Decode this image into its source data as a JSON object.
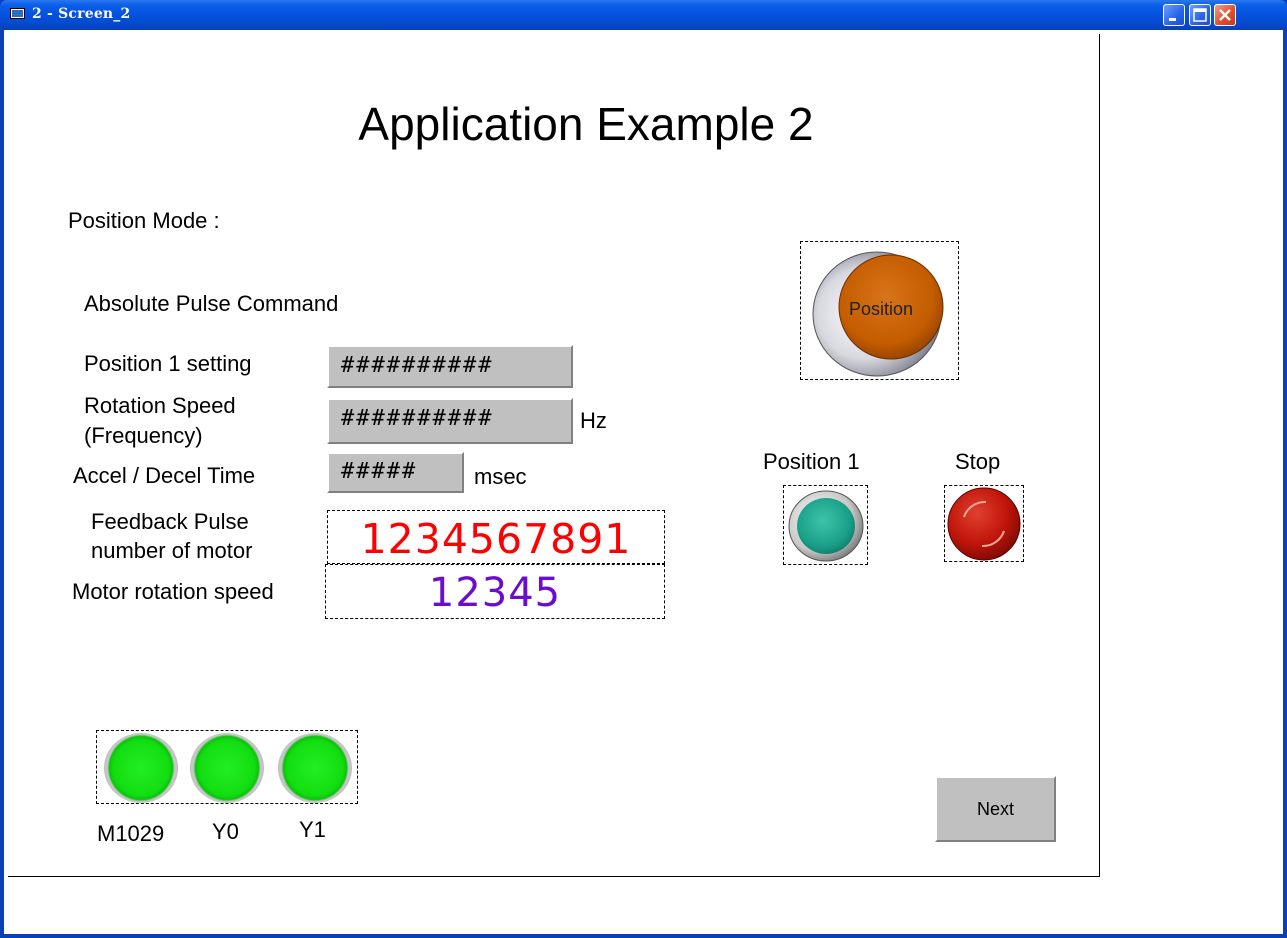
{
  "window": {
    "title": "2 - Screen_2",
    "buttons": [
      "minimize",
      "maximize",
      "close"
    ]
  },
  "screen": {
    "title": "Application Example 2",
    "mode_label": "Position Mode :",
    "section_label": "Absolute Pulse Command",
    "fields": {
      "position1_label": "Position 1 setting",
      "position1_value": "##########",
      "speed_label_1": "Rotation Speed",
      "speed_label_2": "(Frequency)",
      "speed_value": "##########",
      "speed_unit": "Hz",
      "accel_label": "Accel / Decel Time",
      "accel_value": "#####",
      "accel_unit": "msec"
    },
    "feedback": {
      "label_1": "Feedback Pulse",
      "label_2": "number of motor",
      "value": "1234567891",
      "color": "#ff0000"
    },
    "motor_speed": {
      "label": "Motor rotation speed",
      "value": "12345",
      "color": "#6a0dcc"
    },
    "position_button": {
      "label": "Position",
      "color": "#c45c00"
    },
    "position1_button": {
      "label": "Position 1",
      "color": "#1aa08a"
    },
    "stop_button": {
      "label": "Stop",
      "color": "#c0150a"
    },
    "lamps": [
      {
        "label": "M1029",
        "color": "#11dd11"
      },
      {
        "label": "Y0",
        "color": "#11dd11"
      },
      {
        "label": "Y1",
        "color": "#11dd11"
      }
    ],
    "next_button": {
      "label": "Next"
    }
  }
}
